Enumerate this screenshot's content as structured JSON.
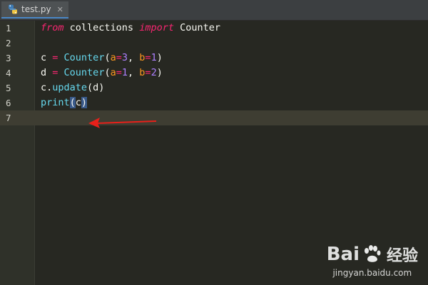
{
  "tab": {
    "filename": "test.py",
    "icon": "python-file-icon"
  },
  "editor": {
    "current_line": 7,
    "lines": [
      {
        "num": "1",
        "tokens": [
          {
            "t": "from",
            "c": "kw"
          },
          {
            "t": " collections ",
            "c": "plain"
          },
          {
            "t": "import",
            "c": "kw"
          },
          {
            "t": " Counter",
            "c": "plain"
          }
        ]
      },
      {
        "num": "2",
        "tokens": []
      },
      {
        "num": "3",
        "tokens": [
          {
            "t": "c ",
            "c": "plain"
          },
          {
            "t": "=",
            "c": "op"
          },
          {
            "t": " ",
            "c": "plain"
          },
          {
            "t": "Counter",
            "c": "cls"
          },
          {
            "t": "(",
            "c": "plain"
          },
          {
            "t": "a",
            "c": "param"
          },
          {
            "t": "=",
            "c": "op"
          },
          {
            "t": "3",
            "c": "num"
          },
          {
            "t": ", ",
            "c": "plain"
          },
          {
            "t": "b",
            "c": "param"
          },
          {
            "t": "=",
            "c": "op"
          },
          {
            "t": "1",
            "c": "num"
          },
          {
            "t": ")",
            "c": "plain"
          }
        ]
      },
      {
        "num": "4",
        "tokens": [
          {
            "t": "d ",
            "c": "plain"
          },
          {
            "t": "=",
            "c": "op"
          },
          {
            "t": " ",
            "c": "plain"
          },
          {
            "t": "Counter",
            "c": "cls"
          },
          {
            "t": "(",
            "c": "plain"
          },
          {
            "t": "a",
            "c": "param"
          },
          {
            "t": "=",
            "c": "op"
          },
          {
            "t": "1",
            "c": "num"
          },
          {
            "t": ", ",
            "c": "plain"
          },
          {
            "t": "b",
            "c": "param"
          },
          {
            "t": "=",
            "c": "op"
          },
          {
            "t": "2",
            "c": "num"
          },
          {
            "t": ")",
            "c": "plain"
          }
        ]
      },
      {
        "num": "5",
        "tokens": [
          {
            "t": "c.",
            "c": "plain"
          },
          {
            "t": "update",
            "c": "fn"
          },
          {
            "t": "(d)",
            "c": "plain"
          }
        ]
      },
      {
        "num": "6",
        "tokens": [
          {
            "t": "print",
            "c": "fn"
          },
          {
            "t": "(",
            "c": "paren-hl"
          },
          {
            "t": "c",
            "c": "plain"
          },
          {
            "t": ")",
            "c": "paren-hl"
          }
        ]
      },
      {
        "num": "7",
        "tokens": []
      }
    ]
  },
  "colors": {
    "background": "#272822",
    "keyword": "#f92672",
    "class": "#66d9ef",
    "param": "#fd971f",
    "number": "#ae81ff",
    "arrow": "#e8201a"
  },
  "watermark": {
    "logo_text_left": "Bai",
    "logo_text_right": "经验",
    "url": "jingyan.baidu.com"
  }
}
